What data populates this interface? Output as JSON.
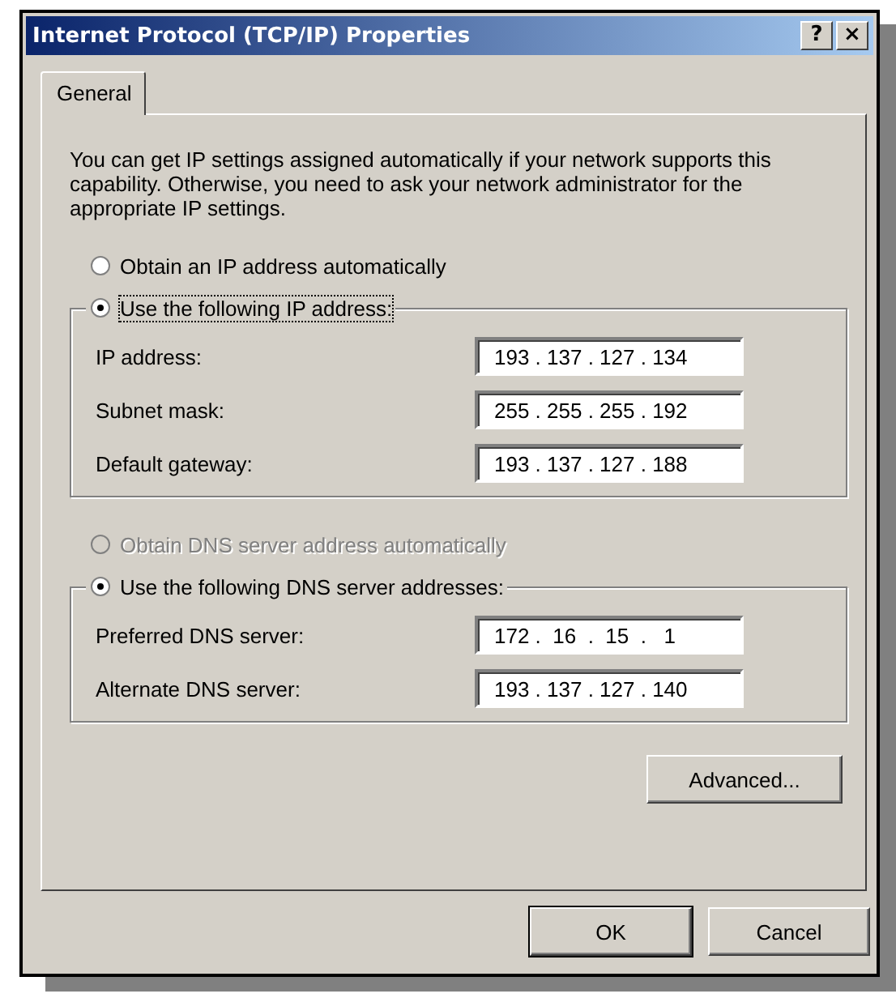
{
  "window": {
    "title": "Internet Protocol (TCP/IP) Properties",
    "title_buttons": [
      "?",
      "×"
    ]
  },
  "tabs": [
    {
      "label": "General",
      "selected": true
    }
  ],
  "intro": "You can get IP settings assigned automatically if your network supports this capability. Otherwise, you need to ask your network administrator for the appropriate IP settings.",
  "sections": [
    {
      "auto_option": {
        "label": "Obtain an IP address automatically",
        "selected": false,
        "disabled": false
      },
      "manual_option": {
        "label": "Use the following IP address:",
        "selected": true,
        "disabled": false,
        "focused": true
      },
      "fields": [
        {
          "label": "IP address:",
          "value": "193 . 137 . 127 . 134"
        },
        {
          "label": "Subnet mask:",
          "value": "255 . 255 . 255 . 192"
        },
        {
          "label": "Default gateway:",
          "value": "193 . 137 . 127 . 188"
        }
      ]
    },
    {
      "auto_option": {
        "label": "Obtain DNS server address automatically",
        "selected": false,
        "disabled": true
      },
      "manual_option": {
        "label": "Use the following DNS server addresses:",
        "selected": true,
        "disabled": false,
        "focused": false
      },
      "fields": [
        {
          "label": "Preferred DNS server:",
          "value": "172 .  16  .  15  .   1"
        },
        {
          "label": "Alternate DNS server:",
          "value": "193 . 137 . 127 . 140"
        }
      ]
    }
  ],
  "advanced_button": "Advanced...",
  "buttons": [
    {
      "label": "OK",
      "default": true
    },
    {
      "label": "Cancel",
      "default": false
    }
  ]
}
